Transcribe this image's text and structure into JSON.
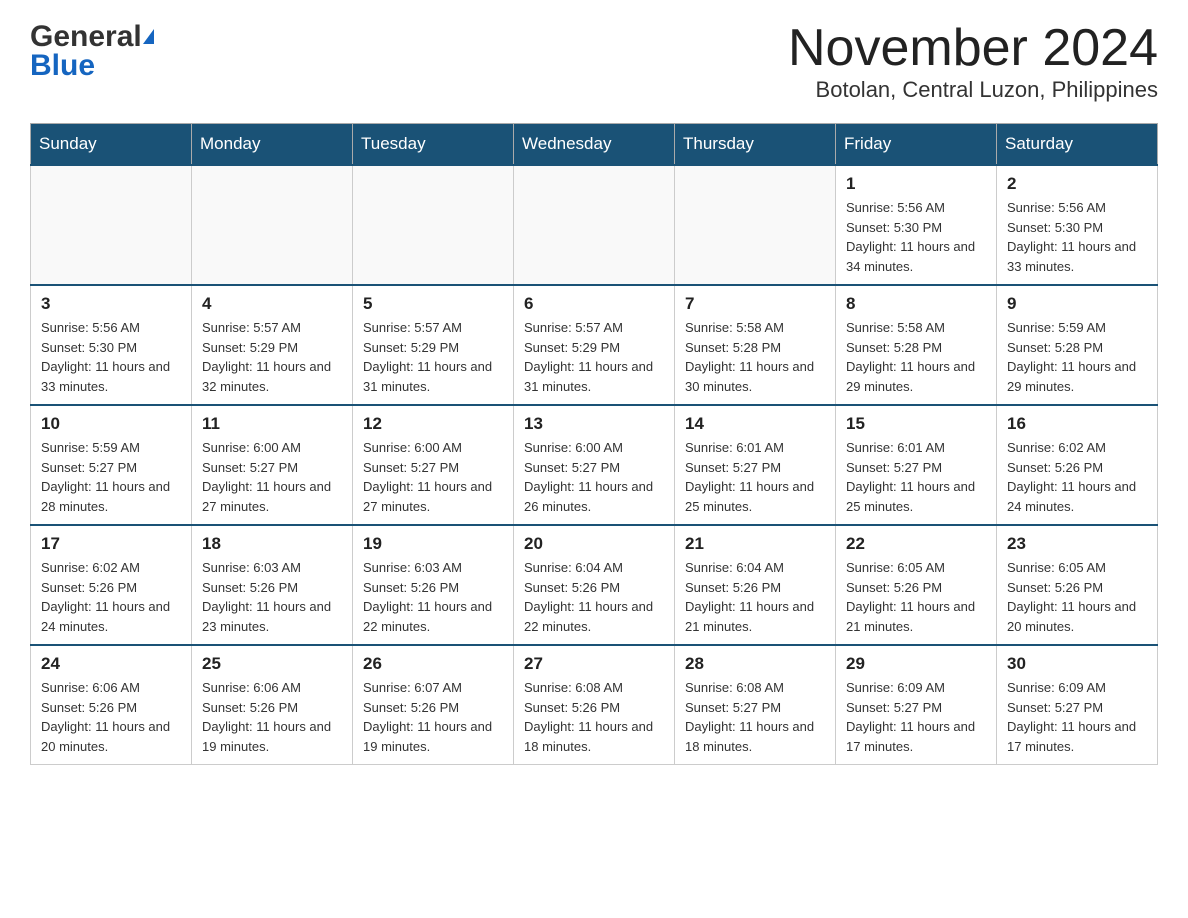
{
  "logo": {
    "general": "General",
    "blue": "Blue"
  },
  "header": {
    "month_year": "November 2024",
    "location": "Botolan, Central Luzon, Philippines"
  },
  "weekdays": [
    "Sunday",
    "Monday",
    "Tuesday",
    "Wednesday",
    "Thursday",
    "Friday",
    "Saturday"
  ],
  "weeks": [
    [
      {
        "day": "",
        "info": ""
      },
      {
        "day": "",
        "info": ""
      },
      {
        "day": "",
        "info": ""
      },
      {
        "day": "",
        "info": ""
      },
      {
        "day": "",
        "info": ""
      },
      {
        "day": "1",
        "info": "Sunrise: 5:56 AM\nSunset: 5:30 PM\nDaylight: 11 hours and 34 minutes."
      },
      {
        "day": "2",
        "info": "Sunrise: 5:56 AM\nSunset: 5:30 PM\nDaylight: 11 hours and 33 minutes."
      }
    ],
    [
      {
        "day": "3",
        "info": "Sunrise: 5:56 AM\nSunset: 5:30 PM\nDaylight: 11 hours and 33 minutes."
      },
      {
        "day": "4",
        "info": "Sunrise: 5:57 AM\nSunset: 5:29 PM\nDaylight: 11 hours and 32 minutes."
      },
      {
        "day": "5",
        "info": "Sunrise: 5:57 AM\nSunset: 5:29 PM\nDaylight: 11 hours and 31 minutes."
      },
      {
        "day": "6",
        "info": "Sunrise: 5:57 AM\nSunset: 5:29 PM\nDaylight: 11 hours and 31 minutes."
      },
      {
        "day": "7",
        "info": "Sunrise: 5:58 AM\nSunset: 5:28 PM\nDaylight: 11 hours and 30 minutes."
      },
      {
        "day": "8",
        "info": "Sunrise: 5:58 AM\nSunset: 5:28 PM\nDaylight: 11 hours and 29 minutes."
      },
      {
        "day": "9",
        "info": "Sunrise: 5:59 AM\nSunset: 5:28 PM\nDaylight: 11 hours and 29 minutes."
      }
    ],
    [
      {
        "day": "10",
        "info": "Sunrise: 5:59 AM\nSunset: 5:27 PM\nDaylight: 11 hours and 28 minutes."
      },
      {
        "day": "11",
        "info": "Sunrise: 6:00 AM\nSunset: 5:27 PM\nDaylight: 11 hours and 27 minutes."
      },
      {
        "day": "12",
        "info": "Sunrise: 6:00 AM\nSunset: 5:27 PM\nDaylight: 11 hours and 27 minutes."
      },
      {
        "day": "13",
        "info": "Sunrise: 6:00 AM\nSunset: 5:27 PM\nDaylight: 11 hours and 26 minutes."
      },
      {
        "day": "14",
        "info": "Sunrise: 6:01 AM\nSunset: 5:27 PM\nDaylight: 11 hours and 25 minutes."
      },
      {
        "day": "15",
        "info": "Sunrise: 6:01 AM\nSunset: 5:27 PM\nDaylight: 11 hours and 25 minutes."
      },
      {
        "day": "16",
        "info": "Sunrise: 6:02 AM\nSunset: 5:26 PM\nDaylight: 11 hours and 24 minutes."
      }
    ],
    [
      {
        "day": "17",
        "info": "Sunrise: 6:02 AM\nSunset: 5:26 PM\nDaylight: 11 hours and 24 minutes."
      },
      {
        "day": "18",
        "info": "Sunrise: 6:03 AM\nSunset: 5:26 PM\nDaylight: 11 hours and 23 minutes."
      },
      {
        "day": "19",
        "info": "Sunrise: 6:03 AM\nSunset: 5:26 PM\nDaylight: 11 hours and 22 minutes."
      },
      {
        "day": "20",
        "info": "Sunrise: 6:04 AM\nSunset: 5:26 PM\nDaylight: 11 hours and 22 minutes."
      },
      {
        "day": "21",
        "info": "Sunrise: 6:04 AM\nSunset: 5:26 PM\nDaylight: 11 hours and 21 minutes."
      },
      {
        "day": "22",
        "info": "Sunrise: 6:05 AM\nSunset: 5:26 PM\nDaylight: 11 hours and 21 minutes."
      },
      {
        "day": "23",
        "info": "Sunrise: 6:05 AM\nSunset: 5:26 PM\nDaylight: 11 hours and 20 minutes."
      }
    ],
    [
      {
        "day": "24",
        "info": "Sunrise: 6:06 AM\nSunset: 5:26 PM\nDaylight: 11 hours and 20 minutes."
      },
      {
        "day": "25",
        "info": "Sunrise: 6:06 AM\nSunset: 5:26 PM\nDaylight: 11 hours and 19 minutes."
      },
      {
        "day": "26",
        "info": "Sunrise: 6:07 AM\nSunset: 5:26 PM\nDaylight: 11 hours and 19 minutes."
      },
      {
        "day": "27",
        "info": "Sunrise: 6:08 AM\nSunset: 5:26 PM\nDaylight: 11 hours and 18 minutes."
      },
      {
        "day": "28",
        "info": "Sunrise: 6:08 AM\nSunset: 5:27 PM\nDaylight: 11 hours and 18 minutes."
      },
      {
        "day": "29",
        "info": "Sunrise: 6:09 AM\nSunset: 5:27 PM\nDaylight: 11 hours and 17 minutes."
      },
      {
        "day": "30",
        "info": "Sunrise: 6:09 AM\nSunset: 5:27 PM\nDaylight: 11 hours and 17 minutes."
      }
    ]
  ]
}
